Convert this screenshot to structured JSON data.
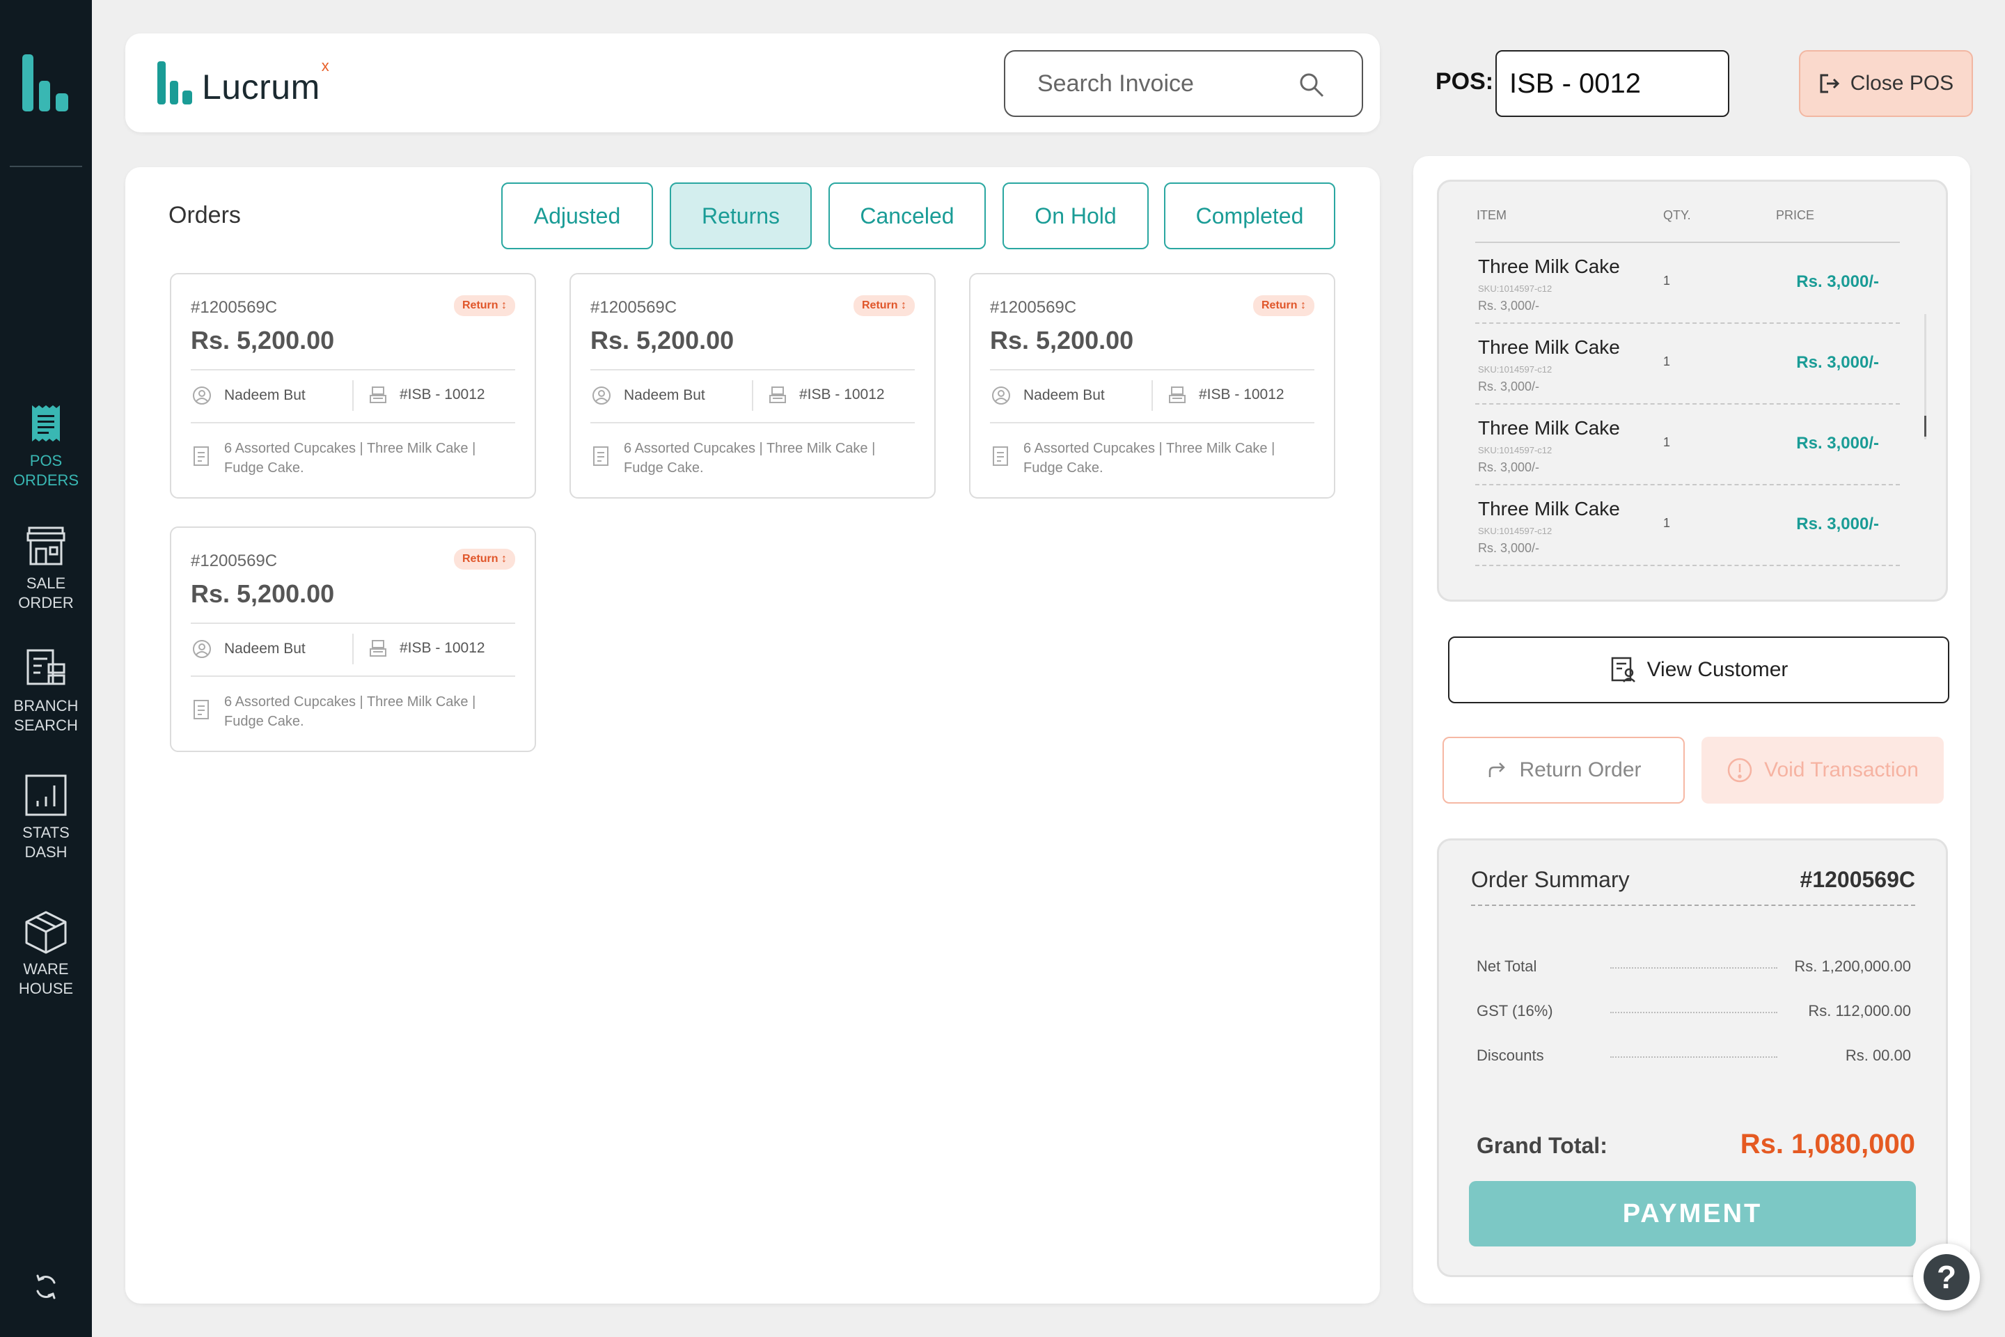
{
  "sidebar": {
    "items": [
      {
        "label": "POS\nORDERS",
        "icon": "receipt-icon",
        "active": true
      },
      {
        "label": "SALE\nORDER",
        "icon": "storefront-icon",
        "active": false
      },
      {
        "label": "BRANCH\nSEARCH",
        "icon": "branch-search-icon",
        "active": false
      },
      {
        "label": "STATS\nDASH",
        "icon": "stats-chart-icon",
        "active": false
      },
      {
        "label": "WARE\nHOUSE",
        "icon": "box-icon",
        "active": false
      }
    ]
  },
  "header": {
    "brand_name": "Lucrum",
    "brand_suffix": "x",
    "search_placeholder": "Search Invoice",
    "pos_label": "POS:",
    "pos_value": "ISB - 0012",
    "close_pos_label": "Close POS"
  },
  "orders": {
    "title": "Orders",
    "tabs": [
      {
        "label": "Adjusted",
        "active": false
      },
      {
        "label": "Returns",
        "active": true
      },
      {
        "label": "Canceled",
        "active": false
      },
      {
        "label": "On Hold",
        "active": false
      },
      {
        "label": "Completed",
        "active": false
      }
    ],
    "cards": [
      {
        "id": "#1200569C",
        "badge": "Return ↕",
        "amount": "Rs. 5,200.00",
        "customer": "Nadeem But",
        "register": "#ISB - 10012",
        "items": "6 Assorted Cupcakes  |  Three Milk Cake  |  Fudge Cake."
      },
      {
        "id": "#1200569C",
        "badge": "Return ↕",
        "amount": "Rs. 5,200.00",
        "customer": "Nadeem But",
        "register": "#ISB - 10012",
        "items": "6 Assorted Cupcakes  |  Three Milk Cake  |  Fudge Cake."
      },
      {
        "id": "#1200569C",
        "badge": "Return ↕",
        "amount": "Rs. 5,200.00",
        "customer": "Nadeem But",
        "register": "#ISB - 10012",
        "items": "6 Assorted Cupcakes  |  Three Milk Cake  |  Fudge Cake."
      },
      {
        "id": "#1200569C",
        "badge": "Return ↕",
        "amount": "Rs. 5,200.00",
        "customer": "Nadeem But",
        "register": "#ISB - 10012",
        "items": "6 Assorted Cupcakes  |  Three Milk Cake  |  Fudge Cake."
      }
    ]
  },
  "cart": {
    "headers": {
      "item": "ITEM",
      "qty": "QTY.",
      "price": "PRICE"
    },
    "rows": [
      {
        "name": "Three Milk Cake",
        "sku": "SKU:1014597-c12",
        "unit_price": "Rs. 3,000/-",
        "qty": "1",
        "price": "Rs. 3,000/-"
      },
      {
        "name": "Three Milk Cake",
        "sku": "SKU:1014597-c12",
        "unit_price": "Rs. 3,000/-",
        "qty": "1",
        "price": "Rs. 3,000/-"
      },
      {
        "name": "Three Milk Cake",
        "sku": "SKU:1014597-c12",
        "unit_price": "Rs. 3,000/-",
        "qty": "1",
        "price": "Rs. 3,000/-"
      },
      {
        "name": "Three Milk Cake",
        "sku": "SKU:1014597-c12",
        "unit_price": "Rs. 3,000/-",
        "qty": "1",
        "price": "Rs. 3,000/-"
      }
    ]
  },
  "actions": {
    "view_customer": "View Customer",
    "return_order": "Return Order",
    "void_transaction": "Void Transaction"
  },
  "summary": {
    "title": "Order Summary",
    "order_id": "#1200569C",
    "rows": [
      {
        "label": "Net Total",
        "value": "Rs. 1,200,000.00"
      },
      {
        "label": "GST (16%)",
        "value": "Rs. 112,000.00"
      },
      {
        "label": "Discounts",
        "value": "Rs. 00.00"
      }
    ],
    "grand_total_label": "Grand Total:",
    "grand_total_value": "Rs. 1,080,000",
    "payment_label": "PAYMENT"
  },
  "help": {
    "label": "?"
  },
  "colors": {
    "accent": "#1a9c96",
    "sidebar_bg": "#0f1a21",
    "danger": "#e55a22",
    "active_nav": "#39b7b3"
  }
}
